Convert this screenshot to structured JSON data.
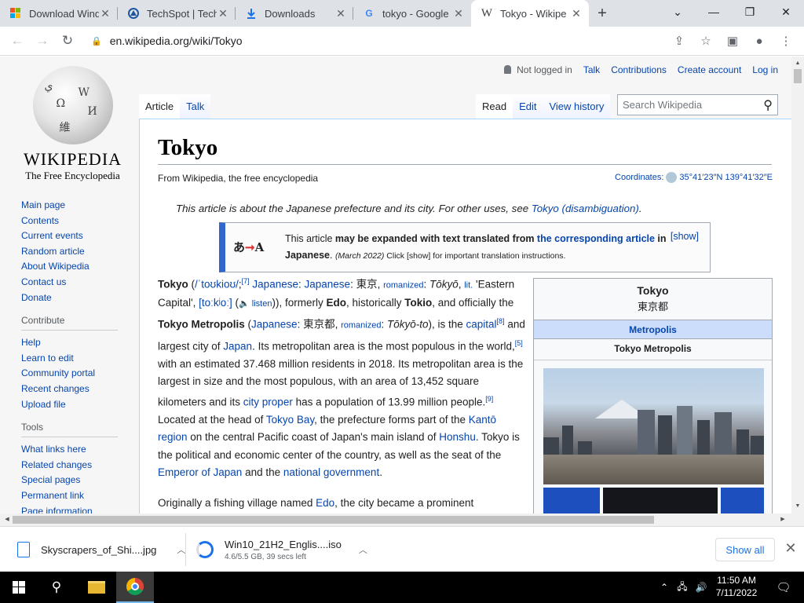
{
  "browser": {
    "tabs": [
      {
        "title": "Download Wind",
        "icon": "windows-logo-icon",
        "close": "✕"
      },
      {
        "title": "TechSpot | Tech",
        "icon": "techspot-icon",
        "close": "✕"
      },
      {
        "title": "Downloads",
        "icon": "download-icon",
        "close": "✕"
      },
      {
        "title": "tokyo - Google",
        "icon": "google-icon",
        "close": "✕"
      },
      {
        "title": "Tokyo - Wikipe",
        "icon": "wikipedia-icon",
        "close": "✕"
      }
    ],
    "new_tab": "+",
    "window_controls": {
      "tab_search": "⌄",
      "minimize": "—",
      "restore": "❐",
      "close": "✕"
    },
    "url": "en.wikipedia.org/wiki/Tokyo",
    "nav": {
      "back": "←",
      "forward": "→",
      "reload": "↻"
    },
    "omni_icons": {
      "lock": "🔒",
      "share": "⇪",
      "bookmark": "☆",
      "sidepanel": "▣",
      "profile": "●",
      "menu": "⋮"
    }
  },
  "wiki": {
    "logo": {
      "wordmark": "WIKIPEDIA",
      "tagline": "The Free Encyclopedia",
      "glyphs": [
        "Ω",
        "W",
        "И",
        "維",
        "ي"
      ]
    },
    "personal": {
      "user": "Not logged in",
      "talk": "Talk",
      "contributions": "Contributions",
      "create_account": "Create account",
      "login": "Log in"
    },
    "tabs_left": [
      "Article",
      "Talk"
    ],
    "tabs_right": [
      "Read",
      "Edit",
      "View history"
    ],
    "search_placeholder": "Search Wikipedia",
    "search_icon": "⚲",
    "sidebar": {
      "main": [
        "Main page",
        "Contents",
        "Current events",
        "Random article",
        "About Wikipedia",
        "Contact us",
        "Donate"
      ],
      "contribute_head": "Contribute",
      "contribute": [
        "Help",
        "Learn to edit",
        "Community portal",
        "Recent changes",
        "Upload file"
      ],
      "tools_head": "Tools",
      "tools": [
        "What links here",
        "Related changes",
        "Special pages",
        "Permanent link",
        "Page information"
      ]
    },
    "title": "Tokyo",
    "from": "From Wikipedia, the free encyclopedia",
    "coords_label": "Coordinates:",
    "coords_value": "35°41′23″N 139°41′32″E",
    "hatnote_text": "This article is about the Japanese prefecture and its city. For other uses, see ",
    "hatnote_link": "Tokyo (disambiguation)",
    "hatnote_end": ".",
    "ambox": {
      "glyph_left": "あ",
      "glyph_arrow": "➞",
      "glyph_right": "A",
      "t1": "This article ",
      "t2": "may be expanded with text translated from ",
      "link": "the corresponding article",
      "t3": " in Japanese",
      "t4": ". ",
      "date": "(March 2022)",
      "t5": " Click [show] for important translation instructions.",
      "show": "[show]"
    },
    "infobox": {
      "title": "Tokyo",
      "native": "東京都",
      "type": "Metropolis",
      "subtitle": "Tokyo Metropolis"
    },
    "para2": {
      "a": "Originally a fishing village named ",
      "link": "Edo",
      "b": ", the city became a prominent"
    }
  },
  "downloads": {
    "items": [
      {
        "name": "Skyscrapers_of_Shi....jpg",
        "meta": ""
      },
      {
        "name": "Win10_21H2_Englis....iso",
        "meta": "4.6/5.5 GB, 39 secs left"
      }
    ],
    "show_all": "Show all",
    "close": "✕"
  },
  "taskbar": {
    "time": "11:50 AM",
    "date": "7/11/2022",
    "start": "⊞",
    "search": "⚲",
    "tray": "⌃",
    "network": "🖧",
    "volume": "🔊",
    "notifications": "🗨"
  },
  "colors": {
    "link": "#0645ad",
    "accent": "#1a73e8",
    "ambox_border": "#3366cc",
    "infobox_header": "#ccddfb"
  }
}
